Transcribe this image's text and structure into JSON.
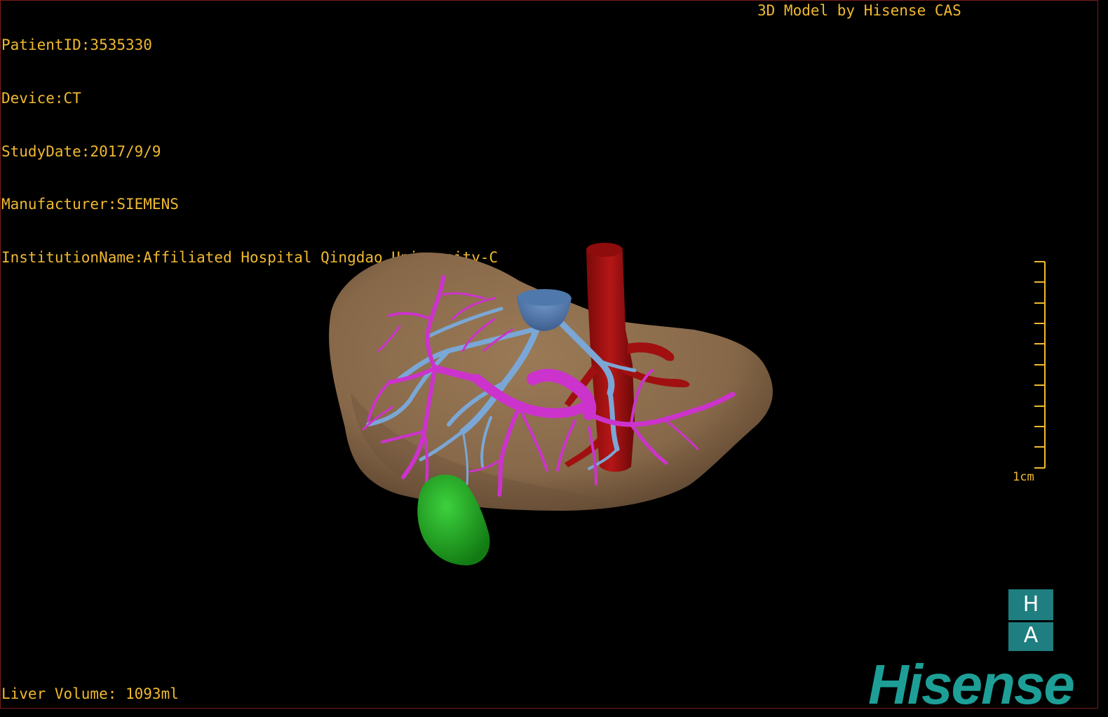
{
  "header": {
    "patient_id": "PatientID:3535330",
    "device": "Device:CT",
    "study_date": "StudyDate:2017/9/9",
    "manufacturer": "Manufacturer:SIEMENS",
    "institution": "InstitutionName:Affiliated Hospital Qingdao University-C"
  },
  "credit": "3D Model by Hisense CAS",
  "scale_bar": {
    "label": "1cm"
  },
  "footer": {
    "liver_volume": "Liver Volume: 1093ml"
  },
  "logo": {
    "badge_top": "H",
    "badge_bottom": "A",
    "brand": "Hisense"
  },
  "colors": {
    "text": "#f0b92f",
    "liver": "#8b6c4a",
    "hepatic_vein": "#7ba7d6",
    "portal_vein": "#cc33cc",
    "ivc": "#a01010",
    "tumor": "#1ea31e",
    "brand": "#1d9f97"
  },
  "model_parts": [
    "liver",
    "hepatic-vein",
    "portal-vein",
    "inferior-vena-cava",
    "tumor"
  ]
}
